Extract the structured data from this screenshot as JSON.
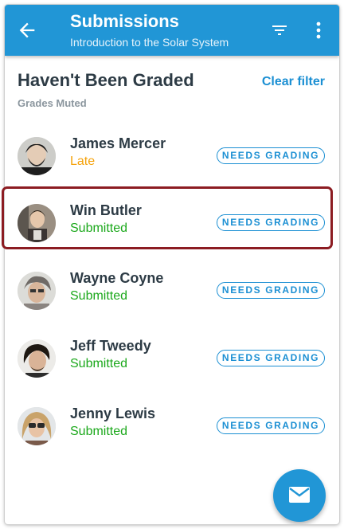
{
  "header": {
    "title": "Submissions",
    "subtitle": "Introduction to the Solar System",
    "back_icon": "arrow-left-icon",
    "filter_icon": "filter-icon",
    "more_icon": "more-vertical-icon",
    "color": "#2196d6"
  },
  "section": {
    "title": "Haven't Been Graded",
    "subtitle": "Grades Muted",
    "clear_filter": "Clear filter"
  },
  "submissions": [
    {
      "name": "James Mercer",
      "status": "Late",
      "badge": "NEEDS GRADING"
    },
    {
      "name": "Win Butler",
      "status": "Submitted",
      "badge": "NEEDS GRADING"
    },
    {
      "name": "Wayne Coyne",
      "status": "Submitted",
      "badge": "NEEDS GRADING"
    },
    {
      "name": "Jeff Tweedy",
      "status": "Submitted",
      "badge": "NEEDS GRADING"
    },
    {
      "name": "Jenny Lewis",
      "status": "Submitted",
      "badge": "NEEDS GRADING"
    }
  ],
  "colors": {
    "late": "#f5a20a",
    "submitted": "#1ba81b",
    "accent": "#1b8fd3",
    "highlight": "#8c1c22"
  },
  "fab": {
    "icon": "mail-icon"
  }
}
